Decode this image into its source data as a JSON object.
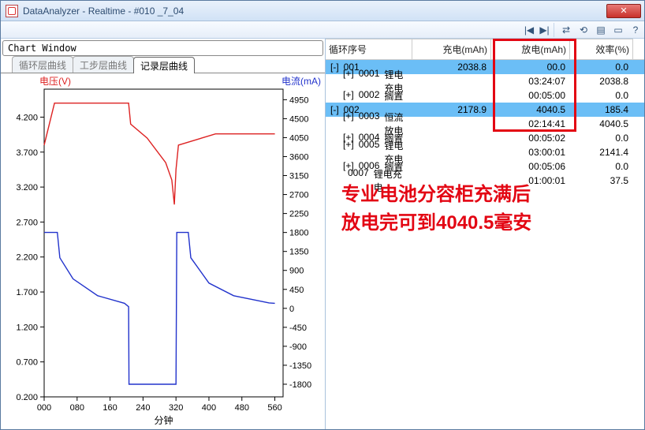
{
  "window": {
    "title": "DataAnalyzer - Realtime - #010 _7_04",
    "close": "✕"
  },
  "toolbar": {
    "prev": "|◀",
    "next": "▶|",
    "refresh1": "⇄",
    "refresh2": "⟲",
    "expand": "▤",
    "collapse": "▭",
    "info": "?"
  },
  "chart": {
    "window_title": "Chart Window",
    "tabs": [
      "循环层曲线",
      "工步层曲线",
      "记录层曲线"
    ],
    "active_tab": 2,
    "y1_label": "电压(V)",
    "y2_label": "电流(mA)",
    "x_label": "分钟"
  },
  "chart_data": {
    "type": "line",
    "xlabel": "分钟",
    "xlim": [
      0,
      580
    ],
    "xticks": [
      0,
      80,
      160,
      240,
      320,
      400,
      480,
      560
    ],
    "series": [
      {
        "name": "电压(V)",
        "axis": "left",
        "ylim": [
          0.2,
          4.6
        ],
        "yticks": [
          0.2,
          0.7,
          1.2,
          1.7,
          2.2,
          2.7,
          3.2,
          3.7,
          4.2
        ],
        "color": "#d22",
        "points": [
          [
            0,
            3.8
          ],
          [
            25,
            4.4
          ],
          [
            70,
            4.4
          ],
          [
            205,
            4.4
          ],
          [
            210,
            4.1
          ],
          [
            250,
            3.9
          ],
          [
            295,
            3.55
          ],
          [
            310,
            3.3
          ],
          [
            316,
            2.95
          ],
          [
            320,
            3.45
          ],
          [
            326,
            3.8
          ],
          [
            416,
            3.96
          ],
          [
            560,
            3.96
          ]
        ]
      },
      {
        "name": "电流(mA)",
        "axis": "right",
        "ylim": [
          -2100,
          5200
        ],
        "yticks": [
          -1800,
          -1350,
          -900,
          -450,
          0,
          450,
          900,
          1350,
          1800,
          2250,
          2700,
          3150,
          3600,
          4050,
          4500,
          4950
        ],
        "color": "#23c",
        "points": [
          [
            0,
            1800
          ],
          [
            32,
            1800
          ],
          [
            38,
            1200
          ],
          [
            70,
            700
          ],
          [
            130,
            300
          ],
          [
            195,
            120
          ],
          [
            205,
            40
          ],
          [
            206,
            -1800
          ],
          [
            315,
            -1800
          ],
          [
            320,
            -1800
          ],
          [
            322,
            1800
          ],
          [
            350,
            1800
          ],
          [
            356,
            1200
          ],
          [
            400,
            600
          ],
          [
            460,
            300
          ],
          [
            546,
            130
          ],
          [
            560,
            120
          ]
        ]
      }
    ]
  },
  "grid": {
    "headers": [
      "循环序号",
      "充电(mAh)",
      "放电(mAh)",
      "效率(%)"
    ],
    "rows": [
      {
        "sel": true,
        "expand": "[-]",
        "id": "001",
        "desc": "",
        "c2": "2038.8",
        "c3": "00.0",
        "c4": "0.0"
      },
      {
        "sel": false,
        "expand": "[+]",
        "id": "0001",
        "desc": "锂电充电",
        "c2": "",
        "c3": "03:24:07",
        "c4": "2038.8",
        "child": true
      },
      {
        "sel": false,
        "expand": "[+]",
        "id": "0002",
        "desc": "搁置",
        "c2": "",
        "c3": "00:05:00",
        "c4": "0.0",
        "child": true
      },
      {
        "sel": true,
        "expand": "[-]",
        "id": "002",
        "desc": "",
        "c2": "2178.9",
        "c3": "4040.5",
        "c4": "185.4"
      },
      {
        "sel": false,
        "expand": "[+]",
        "id": "0003",
        "desc": "恒流放电",
        "c2": "",
        "c3": "02:14:41",
        "c4": "4040.5",
        "child": true
      },
      {
        "sel": false,
        "expand": "[+]",
        "id": "0004",
        "desc": "搁置",
        "c2": "",
        "c3": "00:05:02",
        "c4": "0.0",
        "child": true
      },
      {
        "sel": false,
        "expand": "[+]",
        "id": "0005",
        "desc": "锂电充电",
        "c2": "",
        "c3": "03:00:01",
        "c4": "2141.4",
        "child": true
      },
      {
        "sel": false,
        "expand": "[+]",
        "id": "0006",
        "desc": "搁置",
        "c2": "",
        "c3": "00:05:06",
        "c4": "0.0",
        "child": true
      },
      {
        "sel": false,
        "expand": "",
        "id": "0007",
        "desc": "锂电充电",
        "c2": "",
        "c3": "01:00:01",
        "c4": "37.5",
        "child": true
      }
    ]
  },
  "annotation": {
    "line1": "专业电池分容柜充满后",
    "line2": "放电完可到4040.5毫安"
  }
}
